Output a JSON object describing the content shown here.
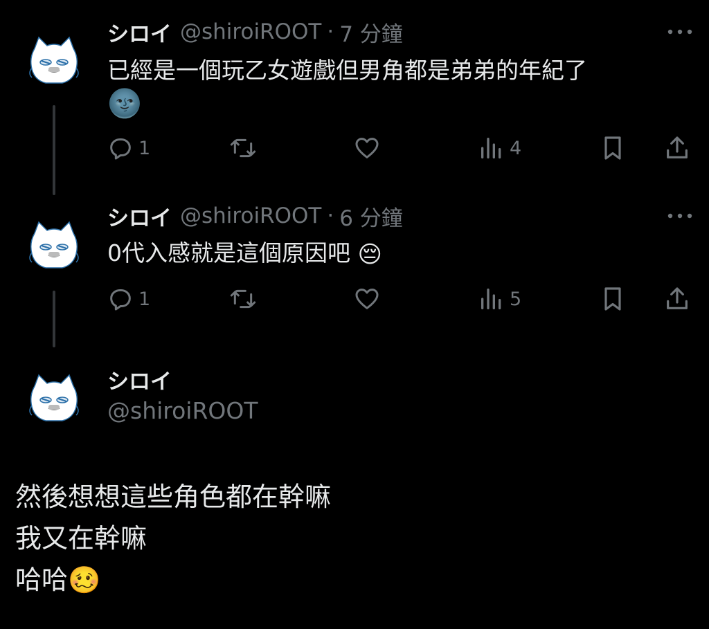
{
  "tweets": [
    {
      "author_name": "シロイ",
      "handle": "@shiroiROOT",
      "separator": "·",
      "time": "7 分鐘",
      "text": "已經是一個玩乙女遊戲但男角都是弟弟的年紀了",
      "emoji": "🌚",
      "reply_count": "1",
      "view_count": "4"
    },
    {
      "author_name": "シロイ",
      "handle": "@shiroiROOT",
      "separator": "·",
      "time": "6 分鐘",
      "text": "0代入感就是這個原因吧",
      "emoji": "😔",
      "reply_count": "1",
      "view_count": "5"
    }
  ],
  "composer": {
    "author_name": "シロイ",
    "handle": "@shiroiROOT",
    "lines": [
      "然後想想這些角色都在幹嘛",
      "我又在幹嘛",
      "哈哈"
    ],
    "emoji": "🥴"
  },
  "colors": {
    "background": "#000000",
    "text": "#e7e9ea",
    "muted": "#71767b",
    "thread_line": "#333639"
  }
}
